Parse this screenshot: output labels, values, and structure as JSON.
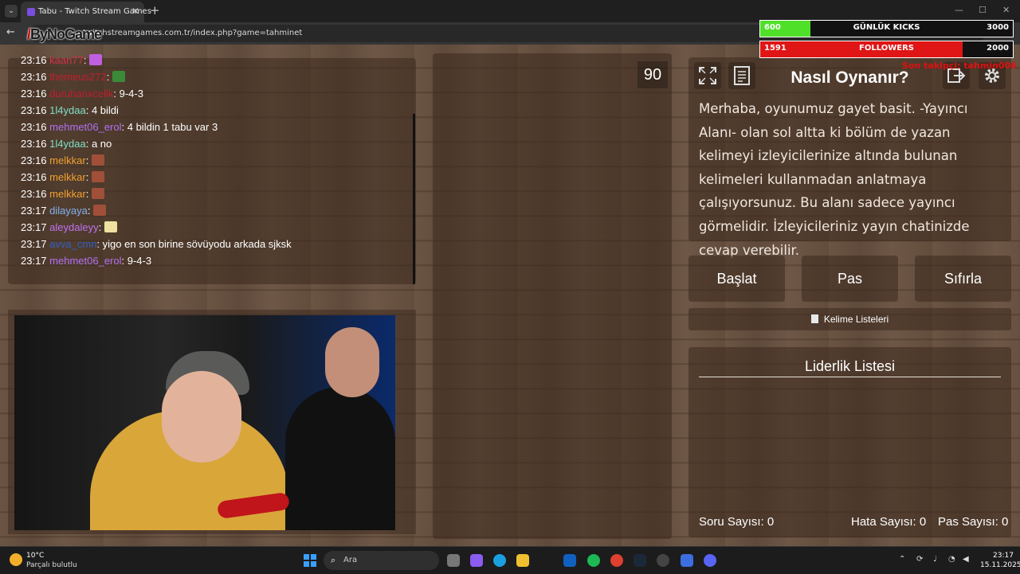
{
  "browser": {
    "tab_title": "Tabu - Twitch Stream Games",
    "url": "twitchstreamgames.com.tr/index.php?game=tahminet",
    "logo_text": "ByNoGame",
    "new_tab": "+",
    "close_tab": "✕",
    "back": "←",
    "minimize": "—",
    "maximize": "☐",
    "close_window": "✕"
  },
  "overlay": {
    "kicks_current": "600",
    "kicks_label": "GÜNLÜK KICKS",
    "kicks_goal": "3000",
    "kicks_progress": 0.2,
    "followers_current": "1591",
    "followers_label": "FOLLOWERS",
    "followers_goal": "2000",
    "followers_progress": 0.8,
    "red_text": "Son takipçi: tahmin006"
  },
  "chat": {
    "messages": [
      {
        "time": "23:16",
        "user": "kaan77",
        "color": "#d0304a",
        "text": "",
        "emote": "#c060e0"
      },
      {
        "time": "23:16",
        "user": "themeus272",
        "color": "#c02030",
        "text": "",
        "emote": "#3a8a3a"
      },
      {
        "time": "23:16",
        "user": "duruhanxcelik",
        "color": "#c02030",
        "text": " 9-4-3",
        "emote": ""
      },
      {
        "time": "23:16",
        "user": "1l4ydaa",
        "color": "#7ee0c8",
        "text": " 4 bildi",
        "emote": ""
      },
      {
        "time": "23:16",
        "user": "mehmet06_erol",
        "color": "#b070f0",
        "text": " 4 bildin 1 tabu var 3",
        "emote": ""
      },
      {
        "time": "23:16",
        "user": "1l4ydaa",
        "color": "#7ee0c8",
        "text": " a no",
        "emote": ""
      },
      {
        "time": "23:16",
        "user": "melkkar",
        "color": "#f0a030",
        "text": "",
        "emote": "#a05038"
      },
      {
        "time": "23:16",
        "user": "melkkar",
        "color": "#f0a030",
        "text": "",
        "emote": "#a05038"
      },
      {
        "time": "23:16",
        "user": "melkkar",
        "color": "#f0a030",
        "text": "",
        "emote": "#a05038"
      },
      {
        "time": "23:17",
        "user": "dilayaya",
        "color": "#80b0f0",
        "text": "",
        "emote": "#a05038"
      },
      {
        "time": "23:17",
        "user": "aleydaleyy",
        "color": "#c070f0",
        "text": "",
        "emote": "#f0e0a0"
      },
      {
        "time": "23:17",
        "user": "avva_cmn",
        "color": "#3060c0",
        "text": " yigo en son birine sövüyodu arkada sjksk",
        "emote": ""
      },
      {
        "time": "23:17",
        "user": "mehmet06_erol",
        "color": "#b070f0",
        "text": " 9-4-3",
        "emote": ""
      }
    ]
  },
  "game": {
    "timer": "90",
    "howto_title": "Nasıl Oynanır?",
    "howto_text": "Merhaba, oyunumuz gayet basit. -Yayıncı Alanı- olan sol altta ki bölüm de yazan kelimeyi izleyicilerinize altında bulunan kelimeleri kullanmadan anlatmaya çalışıyorsunuz. Bu alanı sadece yayıncı görmelidir. İzleyicileriniz yayın chatinizde cevap verebilir.",
    "start_label": "Başlat",
    "pass_label": "Pas",
    "reset_label": "Sıfırla",
    "word_lists_label": "Kelime Listeleri",
    "leaderboard_title": "Liderlik Listesi",
    "question_count": "Soru Sayısı: 0",
    "error_count": "Hata Sayısı: 0",
    "pass_count": "Pas Sayısı: 0"
  },
  "taskbar": {
    "temp": "10°C",
    "weather": "Parçalı bulutlu",
    "search_placeholder": "Ara",
    "time": "23:17",
    "date": "15.11.2025"
  },
  "colors": {
    "kicks_fill": "#4fe02a",
    "followers_fill": "#e01515"
  }
}
